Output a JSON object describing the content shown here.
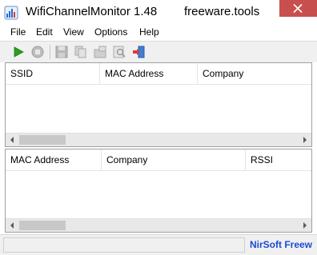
{
  "window": {
    "title": "WifiChannelMonitor 1.48",
    "title_extra": "freeware.tools",
    "icon": "wifi-app-icon",
    "close_icon": "close-icon",
    "close_color": "#c7504f"
  },
  "menu": {
    "items": [
      {
        "label": "File"
      },
      {
        "label": "Edit"
      },
      {
        "label": "View"
      },
      {
        "label": "Options"
      },
      {
        "label": "Help"
      }
    ]
  },
  "toolbar": {
    "buttons": [
      {
        "icon": "play-icon",
        "enabled": true
      },
      {
        "icon": "stop-icon",
        "enabled": false
      },
      {
        "icon": "save-icon",
        "enabled": false
      },
      {
        "icon": "copy-icon",
        "enabled": false
      },
      {
        "icon": "properties-icon",
        "enabled": false
      },
      {
        "icon": "find-icon",
        "enabled": false
      },
      {
        "icon": "exit-icon",
        "enabled": true
      }
    ]
  },
  "top_table": {
    "columns": [
      "SSID",
      "MAC Address",
      "Company"
    ],
    "rows": []
  },
  "bottom_table": {
    "columns": [
      "MAC Address",
      "Company",
      "RSSI"
    ],
    "rows": []
  },
  "status": {
    "text": "",
    "link": "NirSoft Freew"
  },
  "colors": {
    "accent_link": "#1a4bd6",
    "play_green": "#2aa020"
  }
}
